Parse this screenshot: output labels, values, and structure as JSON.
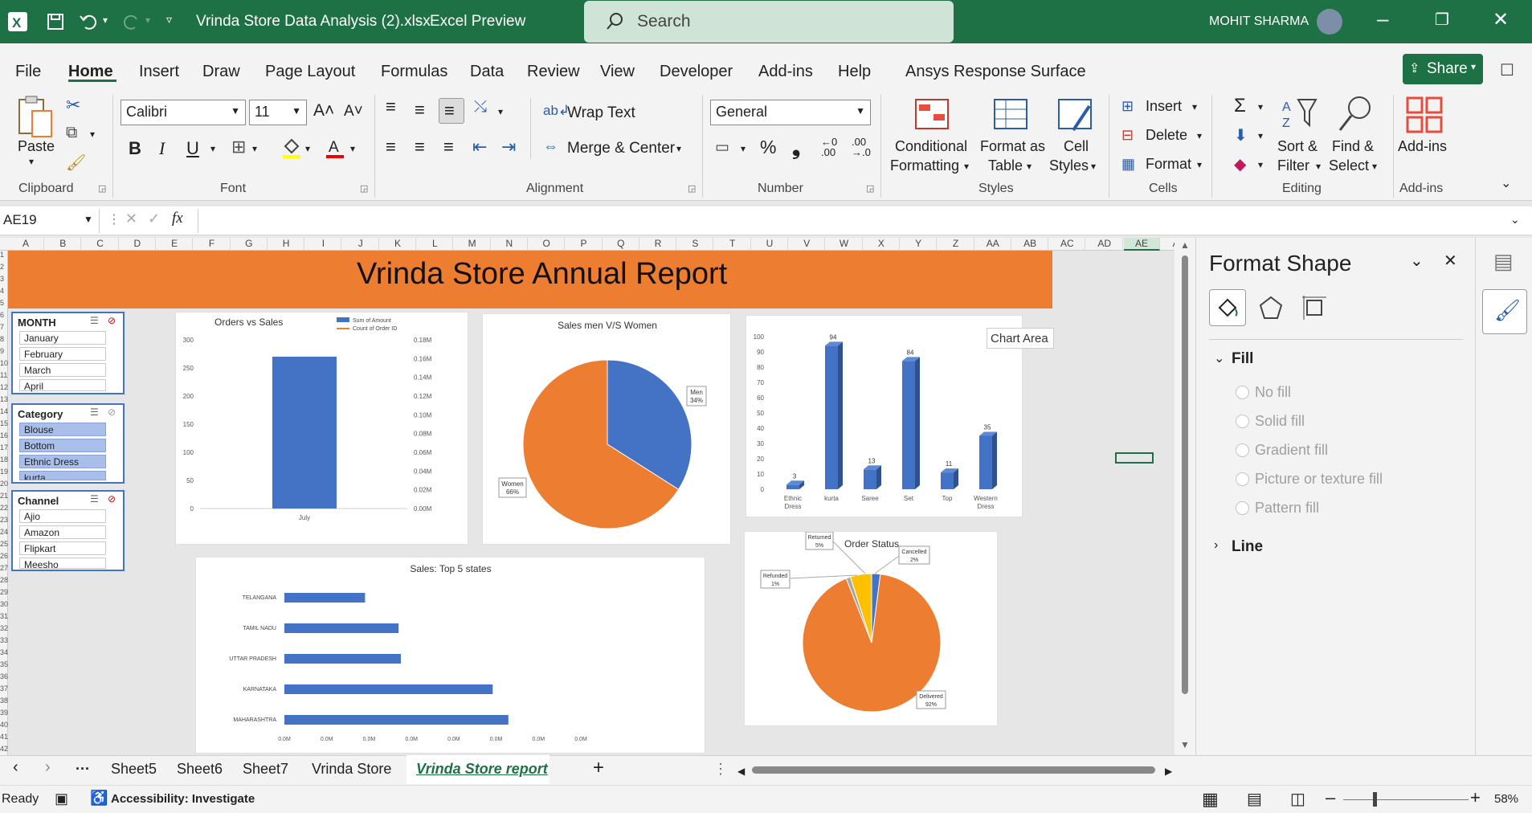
{
  "window": {
    "filename": "Vrinda Store Data Analysis (2).xlsx",
    "separator": "-",
    "app": "Excel Preview",
    "search": "Search",
    "user": "MOHIT SHARMA"
  },
  "menu": [
    "File",
    "Home",
    "Insert",
    "Draw",
    "Page Layout",
    "Formulas",
    "Data",
    "Review",
    "View",
    "Developer",
    "Add-ins",
    "Help",
    "Ansys Response Surface"
  ],
  "share": "Share",
  "ribbon": {
    "paste": "Paste",
    "font_name": "Calibri",
    "font_size": "11",
    "wrap_text": "Wrap Text",
    "merge_center": "Merge & Center",
    "number_format": "General",
    "cond_fmt_1": "Conditional",
    "cond_fmt_2": "Formatting",
    "fmt_table_1": "Format as",
    "fmt_table_2": "Table",
    "cell_styles_1": "Cell",
    "cell_styles_2": "Styles",
    "insert": "Insert",
    "delete": "Delete",
    "format": "Format",
    "sort_1": "Sort &",
    "sort_2": "Filter",
    "find_1": "Find &",
    "find_2": "Select",
    "addins": "Add-ins",
    "groups": {
      "clipboard": "Clipboard",
      "font": "Font",
      "alignment": "Alignment",
      "number": "Number",
      "styles": "Styles",
      "cells": "Cells",
      "editing": "Editing",
      "addins": "Add-ins"
    }
  },
  "formula_bar": {
    "name_box": "AE19",
    "fx": "fx"
  },
  "columns": [
    "A",
    "B",
    "C",
    "D",
    "E",
    "F",
    "G",
    "H",
    "I",
    "J",
    "K",
    "L",
    "M",
    "N",
    "O",
    "P",
    "Q",
    "R",
    "S",
    "T",
    "U",
    "V",
    "W",
    "X",
    "Y",
    "Z",
    "AA",
    "AB",
    "AC",
    "AD",
    "AE",
    "AF"
  ],
  "rows": [
    "1",
    "2",
    "3",
    "4",
    "5",
    "6",
    "7",
    "8",
    "9",
    "10",
    "11",
    "12",
    "13",
    "14",
    "15",
    "16",
    "17",
    "18",
    "19",
    "20",
    "21",
    "22",
    "23",
    "24",
    "25",
    "26",
    "27",
    "28",
    "29",
    "30",
    "31",
    "32",
    "33",
    "34",
    "35",
    "36",
    "37",
    "38",
    "39",
    "40",
    "41",
    "42"
  ],
  "report_title": "Vrinda Store Annual Report",
  "slicers": {
    "month": {
      "title": "MONTH",
      "items": [
        "January",
        "February",
        "March",
        "April"
      ]
    },
    "category": {
      "title": "Category",
      "items": [
        "Blouse",
        "Bottom",
        "Ethnic Dress",
        "kurta"
      ]
    },
    "channel": {
      "title": "Channel",
      "items": [
        "Ajio",
        "Amazon",
        "Flipkart",
        "Meesho"
      ]
    }
  },
  "tooltip": "Chart Area",
  "format_pane": {
    "title": "Format Shape",
    "fill": "Fill",
    "options": [
      "No fill",
      "Solid fill",
      "Gradient fill",
      "Picture or texture fill",
      "Pattern fill"
    ],
    "line": "Line"
  },
  "sheets": [
    "Sheet5",
    "Sheet6",
    "Sheet7",
    "Vrinda Store",
    "Vrinda Store report"
  ],
  "status": {
    "ready": "Ready",
    "accessibility": "Accessibility: Investigate",
    "zoom": "58%"
  },
  "colors": {
    "excel_green": "#1e7145",
    "orange": "#ed7d31",
    "blue": "#4472c4",
    "gold": "#ffc000"
  },
  "chart_data": [
    {
      "type": "bar",
      "title": "Orders vs Sales",
      "categories": [
        "July"
      ],
      "series": [
        {
          "name": "Sum of Amount",
          "values": [
            270
          ]
        },
        {
          "name": "Count of Order ID",
          "values": []
        }
      ],
      "ylim": [
        0,
        300
      ],
      "yticks": [
        "0",
        "50",
        "100",
        "150",
        "200",
        "250",
        "300"
      ],
      "y2ticks": [
        "0.00M",
        "0.02M",
        "0.04M",
        "0.06M",
        "0.08M",
        "0.10M",
        "0.12M",
        "0.14M",
        "0.16M",
        "0.18M"
      ]
    },
    {
      "type": "pie",
      "title": "Sales men V/S Women",
      "slices": [
        {
          "label": "Men",
          "value": 34,
          "text": "34%"
        },
        {
          "label": "Women",
          "value": 66,
          "text": "66%"
        }
      ]
    },
    {
      "type": "bar",
      "categories": [
        "Ethnic Dress",
        "kurta",
        "Saree",
        "Set",
        "Top",
        "Western Dress"
      ],
      "values": [
        3,
        94,
        13,
        84,
        11,
        35
      ],
      "ylim": [
        0,
        100
      ],
      "yticks": [
        "0",
        "10",
        "20",
        "30",
        "40",
        "50",
        "60",
        "70",
        "80",
        "90",
        "100"
      ]
    },
    {
      "type": "bar",
      "title": "Sales: Top 5 states",
      "categories": [
        "TELANGANA",
        "TAMIL NADU",
        "UTTAR PRADESH",
        "KARNATAKA",
        "MAHARASHTRA"
      ],
      "values": [
        0.36,
        0.51,
        0.52,
        0.93,
        1.0
      ],
      "xticks": [
        "0.0M",
        "0.0M",
        "0.0M",
        "0.0M",
        "0.0M",
        "0.0M",
        "0.0M",
        "0.0M"
      ]
    },
    {
      "type": "pie",
      "title": "Order Status",
      "slices": [
        {
          "label": "Delivered",
          "value": 92,
          "text": "92%"
        },
        {
          "label": "Returned",
          "value": 5,
          "text": "5%"
        },
        {
          "label": "Refunded",
          "value": 1,
          "text": "1%"
        },
        {
          "label": "Cancelled",
          "value": 2,
          "text": "2%"
        }
      ]
    }
  ]
}
